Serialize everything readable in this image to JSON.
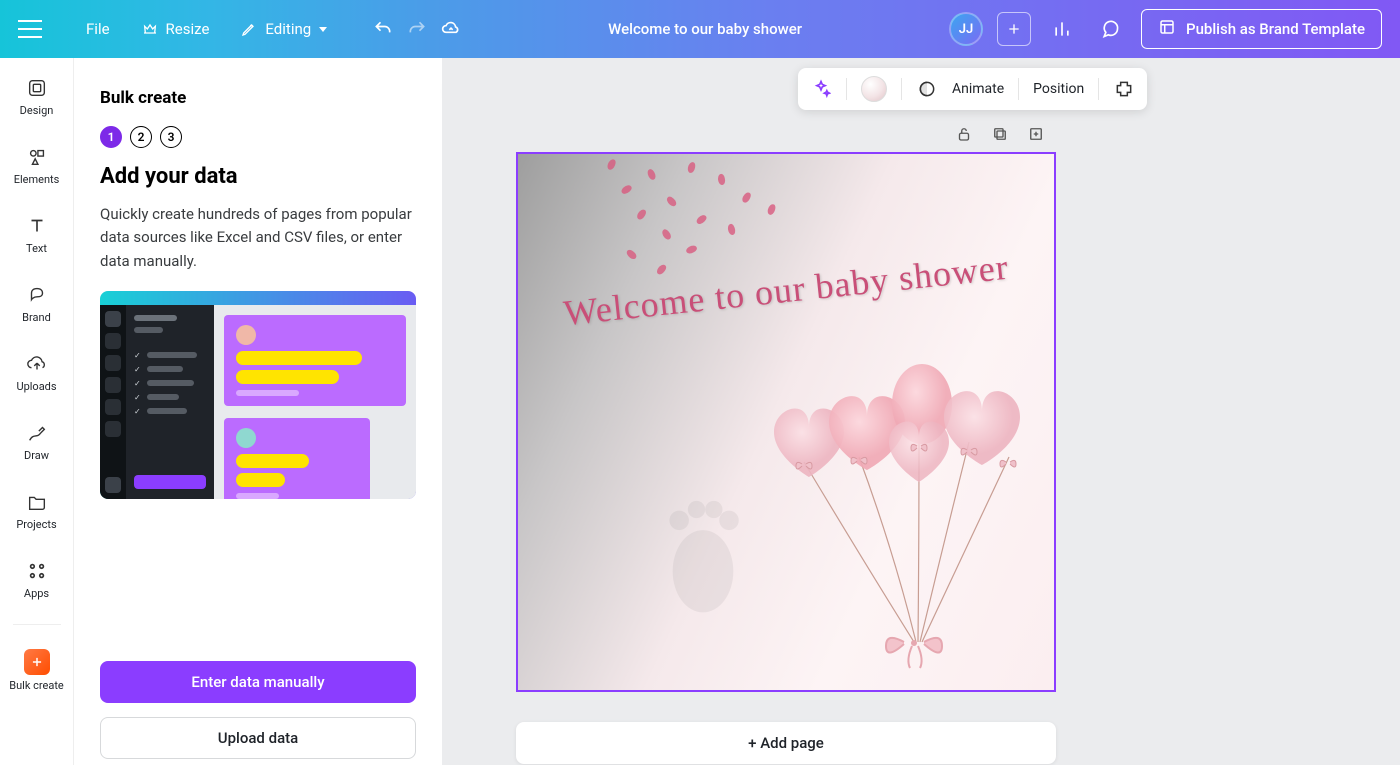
{
  "header": {
    "file": "File",
    "resize": "Resize",
    "editing": "Editing",
    "doc_title": "Welcome to our baby shower",
    "avatar_initials": "JJ",
    "publish": "Publish as Brand Template"
  },
  "rail": {
    "design": "Design",
    "elements": "Elements",
    "text": "Text",
    "brand": "Brand",
    "uploads": "Uploads",
    "draw": "Draw",
    "projects": "Projects",
    "apps": "Apps",
    "bulk_create": "Bulk create"
  },
  "panel": {
    "title": "Bulk create",
    "steps": [
      "1",
      "2",
      "3"
    ],
    "heading": "Add your data",
    "description": "Quickly create hundreds of pages from popular data sources like Excel and CSV files, or enter data manually.",
    "btn_enter": "Enter data manually",
    "btn_upload": "Upload data"
  },
  "float_toolbar": {
    "animate": "Animate",
    "position": "Position"
  },
  "canvas": {
    "script_text": "Welcome to our baby shower",
    "add_page": "+ Add page"
  },
  "colors": {
    "accent": "#8b3dff"
  }
}
